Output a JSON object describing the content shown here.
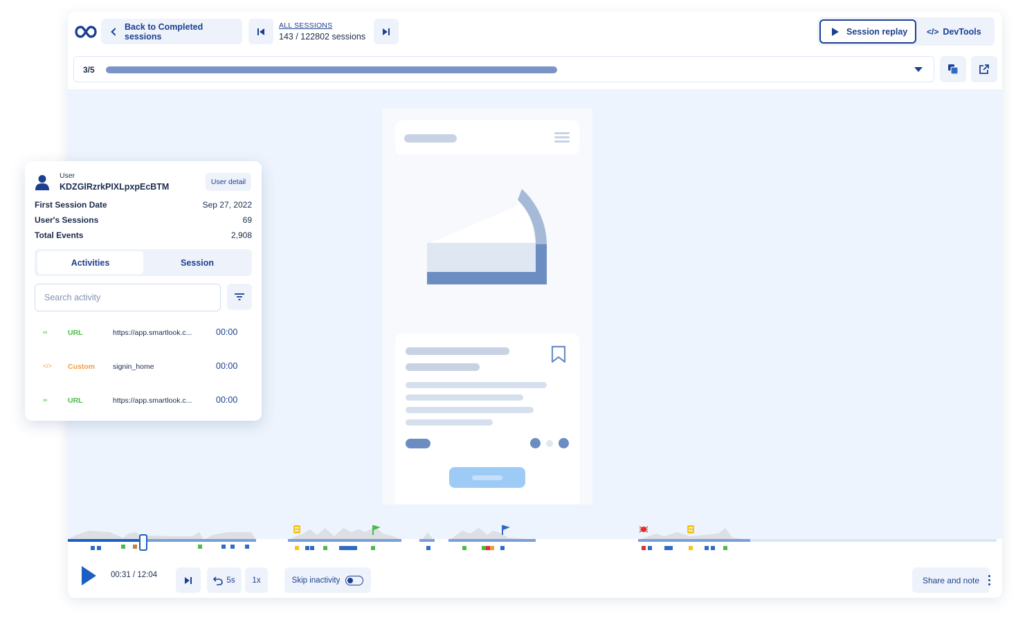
{
  "topbar": {
    "back_label": "Back to Completed sessions",
    "all_sessions_label": "ALL SESSIONS",
    "session_count": "143 / 122802 sessions",
    "session_replay_label": "Session replay",
    "devtools_label": "DevTools"
  },
  "selector": {
    "position": "3/5",
    "progress_fraction": 0.53
  },
  "user_panel": {
    "user_label": "User",
    "user_id": "KDZGlRzrkPIXLpxpEcBTM",
    "user_detail_label": "User detail",
    "stats": [
      {
        "key": "First Session Date",
        "value": "Sep 27, 2022"
      },
      {
        "key": "User's Sessions",
        "value": "69"
      },
      {
        "key": "Total Events",
        "value": "2,908"
      }
    ],
    "tabs": {
      "activities": "Activities",
      "session": "Session"
    },
    "search_placeholder": "Search activity",
    "activities": [
      {
        "icon": "link-icon",
        "type": "URL",
        "value": "https://app.smartlook.c...",
        "time": "00:00",
        "color": "#4cbb4a"
      },
      {
        "icon": "code-icon",
        "type": "Custom",
        "value": "signin_home",
        "time": "00:00",
        "color": "#f29b3d"
      },
      {
        "icon": "link-icon",
        "type": "URL",
        "value": "https://app.smartlook.c...",
        "time": "00:00",
        "color": "#4cbb4a"
      }
    ]
  },
  "controls": {
    "time": "00:31 / 12:04",
    "rewind_label": "5s",
    "speed_label": "1x",
    "skip_inactivity_label": "Skip inactivity",
    "skip_inactivity_on": true,
    "share_label": "Share and note"
  },
  "colors": {
    "brand": "#1c3f8f",
    "accent_bg": "#eef3fb",
    "url_event": "#4cbb4a",
    "custom_event": "#f29b3d",
    "error_event": "#e02f2f",
    "note_event": "#f5c518",
    "click_event": "#2f6bc4"
  }
}
